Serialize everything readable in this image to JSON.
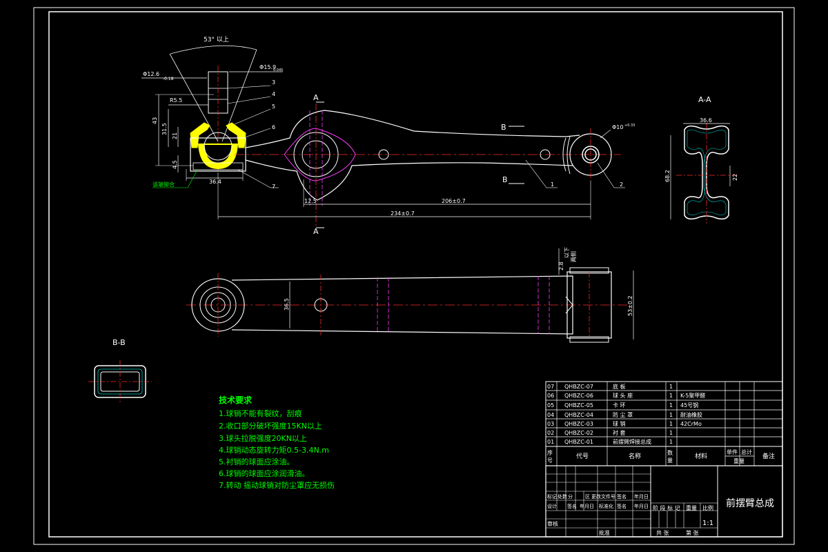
{
  "colors": {
    "background": "#000000",
    "line": "#ffffff",
    "center": "#ff2a2a",
    "hidden": "#ff3cff",
    "annot": "#00ff00",
    "part": "#ffff00",
    "dim": "#ffffff"
  },
  "dims": {
    "angle": "53° 以上",
    "d12": "Φ12.6",
    "d12_tol": "-0.18",
    "d15": "Φ15.9",
    "d15_tol": "0.045",
    "r": "R5.5",
    "h43": "43",
    "h315": "31.5",
    "h21": "21",
    "h45": "4.5",
    "w364": "36.4",
    "d1": "Φ10",
    "d1_tol": "+0.33",
    "l125": "12.5",
    "l206": "206±0.7",
    "l234": "234±0.7",
    "aa_w": "36.6",
    "aa_h": "68.2",
    "aa_22": "22",
    "top_36": "36.5",
    "top_53": "53±0.2",
    "top_28": "2.8",
    "top_28b": "以下",
    "top_28c": "两侧"
  },
  "labels": {
    "fixed_note": "该端铆合",
    "sec_A_top": "A",
    "sec_A_bottom": "A",
    "sec_B_top": "B",
    "sec_B_bottom": "B",
    "aa_title": "A-A",
    "bb_title": "B-B"
  },
  "callouts": [
    "3",
    "4",
    "5",
    "6",
    "7",
    "1",
    "2"
  ],
  "tech": {
    "title": "技术要求",
    "items": [
      "1.球销不能有裂纹，刮痕",
      "2.收口部分破坏强度15KN以上",
      "3.球头拉脱强度20KN以上",
      "4.球销动态旋转力矩0.5-3.4N.m",
      "5.衬销的球面应涂油。",
      "6.球销的球面应涂润滑油。",
      "7.转动 摇动球销对防尘罩应无损伤"
    ]
  },
  "bom": {
    "rows": [
      {
        "no": "07",
        "code": "QHBZC-07",
        "name": "底    板",
        "qty": "1",
        "material": ""
      },
      {
        "no": "06",
        "code": "QHBZC-06",
        "name": "球 头 座",
        "qty": "1",
        "material": "K-5聚甲醛"
      },
      {
        "no": "05",
        "code": "QHBZC-05",
        "name": "卡    环",
        "qty": "1",
        "material": "45号钢"
      },
      {
        "no": "04",
        "code": "QHBZC-04",
        "name": "防 尘 罩",
        "qty": "1",
        "material": "耐油橡胶"
      },
      {
        "no": "03",
        "code": "QHBZC-03",
        "name": "球    销",
        "qty": "1",
        "material": "42CrMo"
      },
      {
        "no": "02",
        "code": "QHBZC-02",
        "name": "衬    套",
        "qty": "1",
        "material": ""
      },
      {
        "no": "01",
        "code": "QHBZC-01",
        "name": "前摆臂焊接总成",
        "qty": "1",
        "material": ""
      }
    ],
    "header": {
      "no": "序号",
      "code": "代号",
      "name": "名称",
      "qty": "数量",
      "material": "材料",
      "single": "单件",
      "total": "总计",
      "weight": "重量",
      "note": "备注"
    }
  },
  "titleblock": {
    "drawing_title": "前摆臂总成",
    "scale": "1:1",
    "row1": [
      "标记",
      "处数",
      "分",
      "区",
      "更改文件号",
      "签名",
      "年月日"
    ],
    "row2": [
      "设计",
      "签名",
      "年月日",
      "标准化",
      "签名",
      "年月日"
    ],
    "stage": "阶 段 标 记",
    "weight": "重量",
    "ratio": "比例",
    "audit": "审核",
    "approve": "批准",
    "total": "共    张",
    "sheet": "第    张"
  }
}
